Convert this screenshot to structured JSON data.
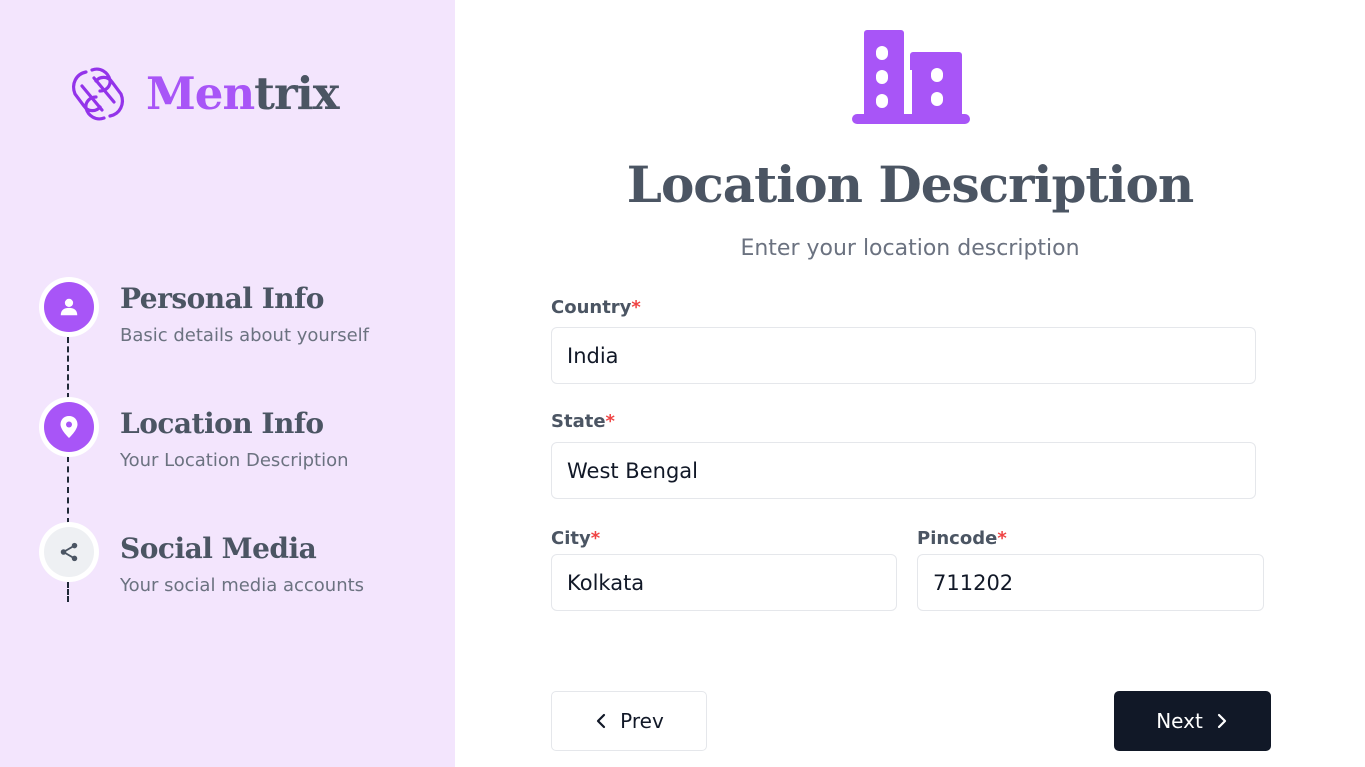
{
  "brand": {
    "name_part1": "Men",
    "name_part2": "trix",
    "logo_icon": "linked-rings-logo"
  },
  "steps": [
    {
      "title": "Personal Info",
      "description": "Basic details about yourself",
      "icon": "user-icon",
      "active": true
    },
    {
      "title": "Location Info",
      "description": "Your Location Description",
      "icon": "map-pin-icon",
      "active": true
    },
    {
      "title": "Social Media",
      "description": "Your social media accounts",
      "icon": "share-icon",
      "active": false
    }
  ],
  "main": {
    "hero_icon": "building-icon",
    "title": "Location Description",
    "subtitle": "Enter your location description"
  },
  "form": {
    "country": {
      "label": "Country",
      "required_mark": "*",
      "value": "India"
    },
    "state": {
      "label": "State",
      "required_mark": "*",
      "value": "West Bengal"
    },
    "city": {
      "label": "City",
      "required_mark": "*",
      "value": "Kolkata"
    },
    "pincode": {
      "label": "Pincode",
      "required_mark": "*",
      "value": "711202"
    }
  },
  "nav": {
    "prev_label": "Prev",
    "next_label": "Next"
  },
  "colors": {
    "accent": "#a855f7",
    "sidebar_bg": "#f3e5fd",
    "primary_button": "#111827",
    "required": "#ef4444"
  }
}
